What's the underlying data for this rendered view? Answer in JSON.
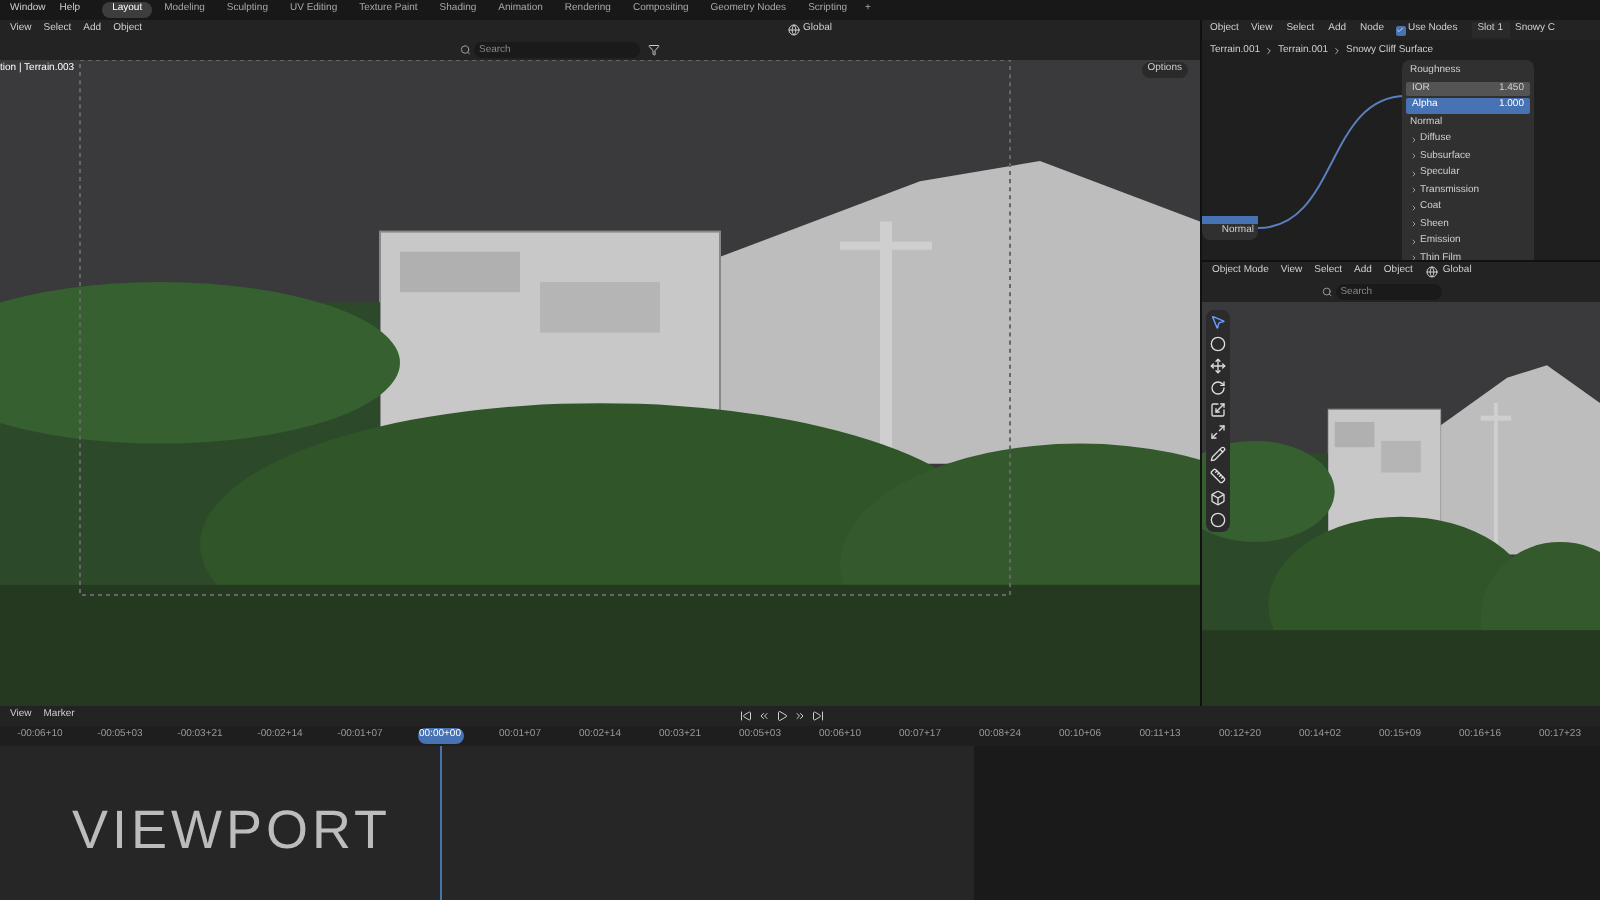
{
  "top_menu": [
    "Window",
    "Help"
  ],
  "workspace_tabs": [
    {
      "label": "Layout",
      "selected": true
    },
    {
      "label": "Modeling",
      "selected": false
    },
    {
      "label": "Sculpting",
      "selected": false
    },
    {
      "label": "UV Editing",
      "selected": false
    },
    {
      "label": "Texture Paint",
      "selected": false
    },
    {
      "label": "Shading",
      "selected": false
    },
    {
      "label": "Animation",
      "selected": false
    },
    {
      "label": "Rendering",
      "selected": false
    },
    {
      "label": "Compositing",
      "selected": false
    },
    {
      "label": "Geometry Nodes",
      "selected": false
    },
    {
      "label": "Scripting",
      "selected": false
    }
  ],
  "add_tab": "+",
  "viewport": {
    "menus": [
      "View",
      "Select",
      "Add",
      "Object"
    ],
    "transform_orientation": "Global",
    "search": {
      "placeholder": "Search"
    },
    "options": "Options",
    "object_label": "tion | Terrain.003"
  },
  "node_editor": {
    "object_type": "Object",
    "menus": [
      "View",
      "Select",
      "Add",
      "Node"
    ],
    "use_nodes": {
      "label": "Use Nodes",
      "checked": true
    },
    "slot": "Slot 1",
    "material": "Snowy C",
    "breadcrumbs": [
      "Terrain.001",
      "Terrain.001",
      "Snowy Cliff Surface"
    ],
    "node_rows": [
      {
        "kind": "label",
        "label": "Roughness"
      },
      {
        "kind": "value",
        "label": "IOR",
        "value": "1.450",
        "selected": false
      },
      {
        "kind": "value",
        "label": "Alpha",
        "value": "1.000",
        "selected": true
      },
      {
        "kind": "socket",
        "label": "Normal"
      }
    ],
    "panels": [
      "Diffuse",
      "Subsurface",
      "Specular",
      "Transmission",
      "Coat",
      "Sheen",
      "Emission",
      "Thin Film"
    ],
    "source_output": "Normal"
  },
  "side_viewport": {
    "mode": "Object Mode",
    "menus": [
      "View",
      "Select",
      "Add",
      "Object"
    ],
    "transform_orientation": "Global",
    "search": {
      "placeholder": "Search"
    }
  },
  "timeline": {
    "menus": [
      "View",
      "Marker"
    ],
    "overlay_title": "VIEWPORT",
    "ticks": [
      {
        "label": "-00:06+10",
        "selected": false
      },
      {
        "label": "-00:05+03",
        "selected": false
      },
      {
        "label": "-00:03+21",
        "selected": false
      },
      {
        "label": "-00:02+14",
        "selected": false
      },
      {
        "label": "-00:01+07",
        "selected": false
      },
      {
        "label": "00:00+00",
        "selected": true
      },
      {
        "label": "00:01+07",
        "selected": false
      },
      {
        "label": "00:02+14",
        "selected": false
      },
      {
        "label": "00:03+21",
        "selected": false
      },
      {
        "label": "00:05+03",
        "selected": false
      },
      {
        "label": "00:06+10",
        "selected": false
      },
      {
        "label": "00:07+17",
        "selected": false
      },
      {
        "label": "00:08+24",
        "selected": false
      },
      {
        "label": "00:10+06",
        "selected": false
      },
      {
        "label": "00:11+13",
        "selected": false
      },
      {
        "label": "00:12+20",
        "selected": false
      },
      {
        "label": "00:14+02",
        "selected": false
      },
      {
        "label": "00:15+09",
        "selected": false
      },
      {
        "label": "00:16+16",
        "selected": false
      },
      {
        "label": "00:17+23",
        "selected": false
      }
    ]
  }
}
